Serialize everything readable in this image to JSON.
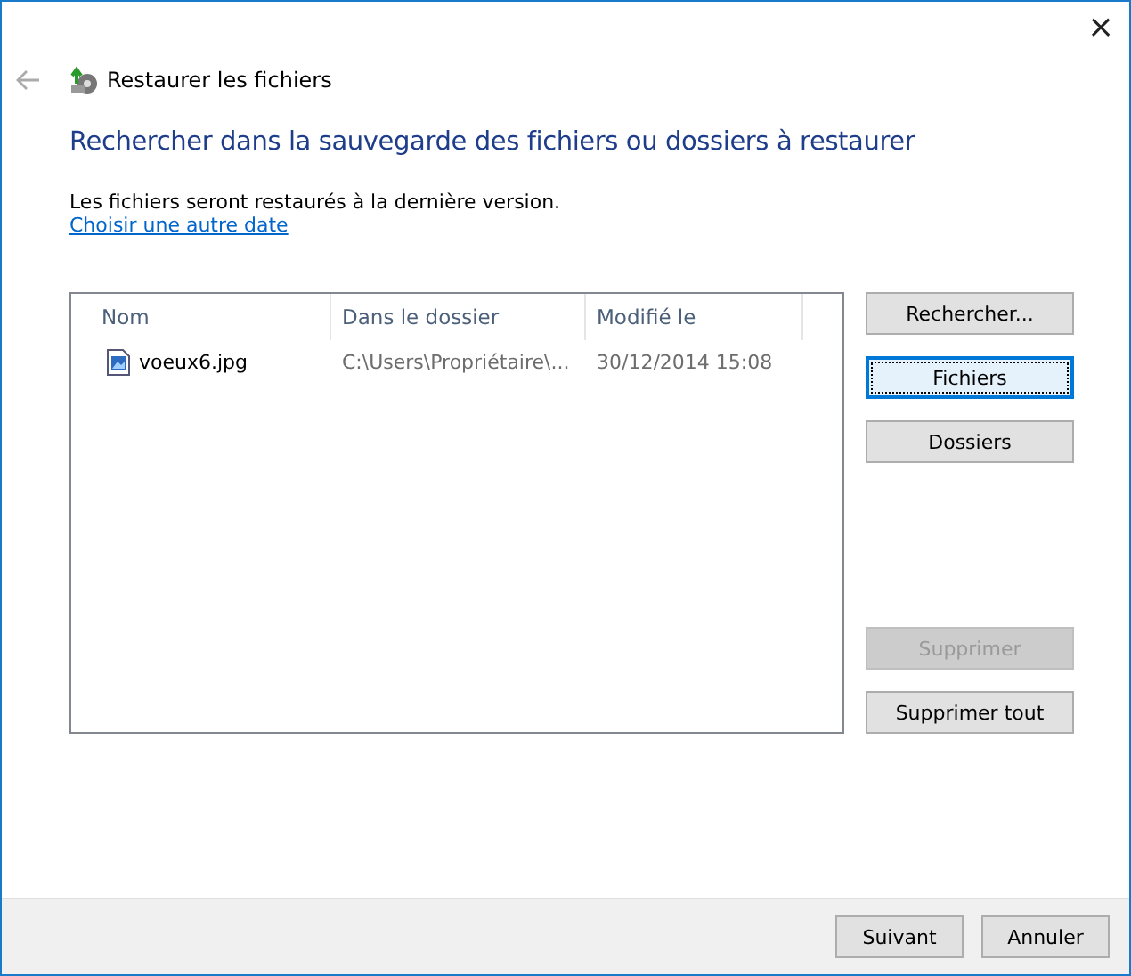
{
  "window": {
    "close": "×",
    "title": "Restaurer les fichiers"
  },
  "heading": "Rechercher dans la sauvegarde des fichiers ou dossiers à restaurer",
  "info": "Les fichiers seront restaurés à la dernière version.",
  "link": "Choisir une autre date",
  "table": {
    "columns": [
      "Nom",
      "Dans le dossier",
      "Modifié le"
    ],
    "rows": [
      {
        "cells": [
          "voeux6.jpg",
          "C:\\Users\\Propriétaire\\...",
          "30/12/2014 15:08"
        ],
        "selected": false
      }
    ]
  },
  "side_buttons": [
    {
      "label": "Rechercher...",
      "focused": false,
      "disabled": false,
      "kind": "top"
    },
    {
      "label": "Fichiers",
      "focused": true,
      "disabled": false,
      "kind": "top"
    },
    {
      "label": "Dossiers",
      "focused": false,
      "disabled": false,
      "kind": "top"
    },
    {
      "label": "Supprimer",
      "focused": false,
      "disabled": true,
      "kind": "bottom"
    },
    {
      "label": "Supprimer tout",
      "focused": false,
      "disabled": false,
      "kind": "bottom"
    }
  ],
  "footer_buttons": [
    {
      "label": "Suivant",
      "disabled": false
    },
    {
      "label": "Annuler",
      "disabled": false
    }
  ]
}
